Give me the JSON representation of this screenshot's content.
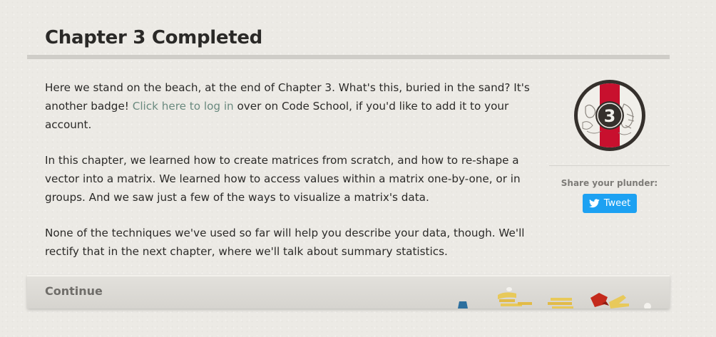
{
  "heading": "Chapter 3 Completed",
  "content": {
    "p1_before": "Here we stand on the beach, at the end of Chapter 3. What's this, buried in the sand? It's another badge! ",
    "p1_link": "Click here to log in",
    "p1_after": " over on Code School, if you'd like to add it to your account.",
    "p2": "In this chapter, we learned how to create matrices from scratch, and how to re-shape a vector into a matrix. We learned how to access values within a matrix one-by-one, or in groups. And we saw just a few of the ways to visualize a matrix's data.",
    "p3": "None of the techniques we've used so far will help you describe your data, though. We'll rectify that in the next chapter, where we'll talk about summary statistics."
  },
  "badge": {
    "number": "3",
    "icon": "chapter-badge-icon",
    "colors": {
      "ring": "#35302c",
      "stripe": "#c8102e",
      "center": "#35302c"
    }
  },
  "share": {
    "label": "Share your plunder:",
    "tweet_label": "Tweet",
    "tweet_color": "#1da1f2"
  },
  "footer": {
    "continue_label": "Continue"
  }
}
